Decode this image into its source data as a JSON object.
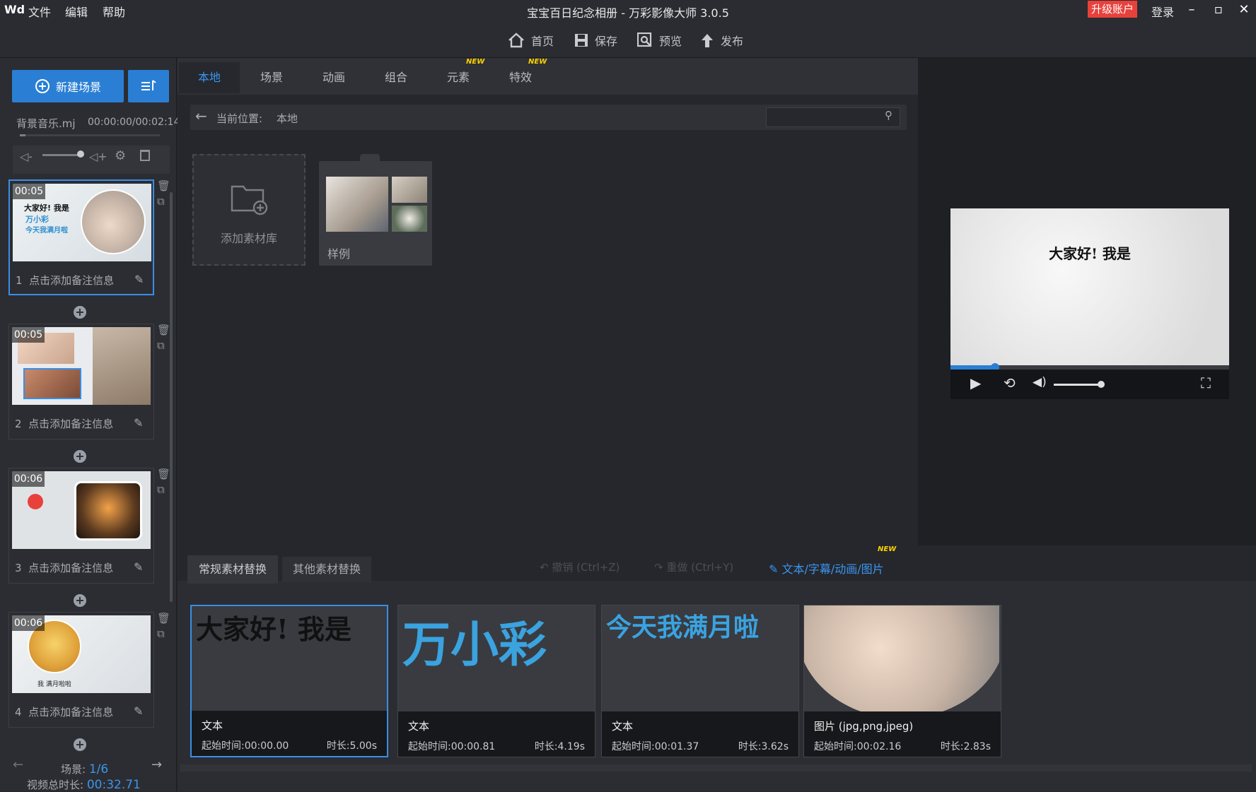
{
  "app": {
    "logo": "Wd",
    "title": "宝宝百日纪念相册 - 万彩影像大师 3.0.5",
    "menu": [
      "文件",
      "编辑",
      "帮助"
    ],
    "upgrade_label": "升级账户",
    "login_label": "登录"
  },
  "toolbar": {
    "home": "首页",
    "save": "保存",
    "preview": "预览",
    "publish": "发布"
  },
  "left": {
    "new_scene": "新建场景",
    "music_name": "背景音乐.mj",
    "music_time": "00:00:00/00:02:14",
    "scenes": [
      {
        "index": "1",
        "duration": "00:05",
        "note": "点击添加备注信息"
      },
      {
        "index": "2",
        "duration": "00:05",
        "note": "点击添加备注信息"
      },
      {
        "index": "3",
        "duration": "00:06",
        "note": "点击添加备注信息"
      },
      {
        "index": "4",
        "duration": "00:06",
        "note": "点击添加备注信息"
      }
    ],
    "scene1_lines": [
      "大家好! 我是",
      "万小彩",
      "今天我满月啦"
    ],
    "scene4_caption": "我 满月啦啦",
    "scene_label": "场景: ",
    "scene_page": "1/6",
    "total_label": "视频总时长: ",
    "total_value": "00:32.71"
  },
  "center": {
    "tabs": [
      "本地",
      "场景",
      "动画",
      "组合",
      "元素",
      "特效"
    ],
    "new_badge": "NEW",
    "location_label": "当前位置:",
    "location_value": "本地",
    "search_placeholder": "",
    "add_library": "添加素材库",
    "sample_folder": "样例"
  },
  "preview": {
    "text": "大家好! 我是",
    "progress": 0.16,
    "volume": 0.95
  },
  "bottom": {
    "tabs": [
      "常规素材替换",
      "其他素材替换"
    ],
    "undo": "撤销 (Ctrl+Z)",
    "redo": "重做 (Ctrl+Y)",
    "edit_link": "文本/字幕/动画/图片",
    "cards": [
      {
        "big": "大家好! 我是",
        "type": "文本",
        "start": "起始时间:00:00.00",
        "dur": "时长:5.00s",
        "color": "#111111"
      },
      {
        "big": "万小彩",
        "type": "文本",
        "start": "起始时间:00:00.81",
        "dur": "时长:4.19s",
        "color": "#3aa3e0"
      },
      {
        "big": "今天我满月啦",
        "type": "文本",
        "start": "起始时间:00:01.37",
        "dur": "时长:3.62s",
        "color": "#3aa3e0"
      },
      {
        "big": "",
        "type": "图片 (jpg,png,jpeg)",
        "start": "起始时间:00:02.16",
        "dur": "时长:2.83s",
        "color": ""
      }
    ]
  },
  "colors": {
    "accent": "#2a7fd4",
    "upgrade": "#e8413c",
    "badge": "#ffd100"
  }
}
